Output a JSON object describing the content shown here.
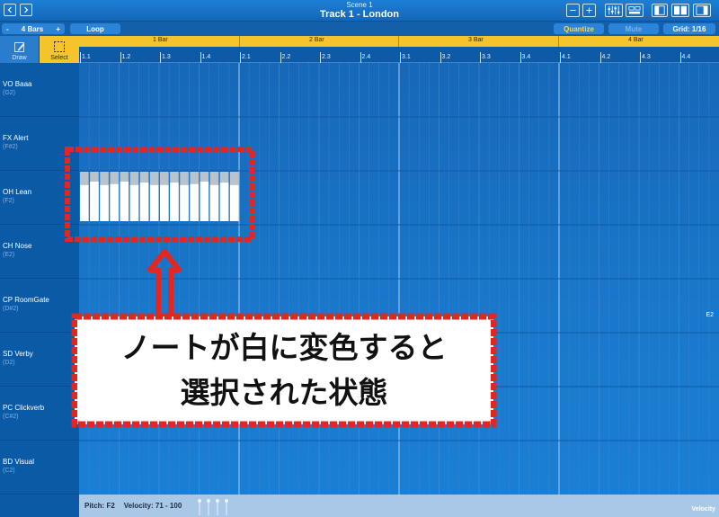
{
  "header": {
    "scene": "Scene 1",
    "track": "Track 1 - London"
  },
  "toolbar": {
    "minus": "-",
    "bars_label": "4 Bars",
    "plus": "+",
    "loop_label": "Loop",
    "quantize_label": "Quantize",
    "mute_label": "Mute",
    "grid_label": "Grid: 1/16"
  },
  "tools": {
    "draw_label": "Draw",
    "select_label": "Select"
  },
  "ruler": {
    "bars": [
      "1 Bar",
      "2 Bar",
      "3 Bar",
      "4 Bar"
    ],
    "beats": [
      "1.1",
      "1.2",
      "1.3",
      "1.4",
      "2.1",
      "2.2",
      "2.3",
      "2.4",
      "3.1",
      "3.2",
      "3.3",
      "3.4",
      "4.1",
      "4.2",
      "4.3",
      "4.4"
    ]
  },
  "tracks": [
    {
      "name": "VO Baaa",
      "note": "(G2)"
    },
    {
      "name": "FX Alert",
      "note": "(F#2)"
    },
    {
      "name": "OH Lean",
      "note": "(F2)"
    },
    {
      "name": "CH Nose",
      "note": "(E2)"
    },
    {
      "name": "CP RoomGate",
      "note": "(D#2)"
    },
    {
      "name": "SD Verby",
      "note": "(D2)"
    },
    {
      "name": "PC Clickverb",
      "note": "(C#2)"
    },
    {
      "name": "BD Visual",
      "note": "(C2)"
    }
  ],
  "edge_note": "E2",
  "notes": {
    "count": 16,
    "velocities": [
      0.73,
      0.8,
      0.73,
      0.75,
      0.8,
      0.73,
      0.78,
      0.73,
      0.73,
      0.78,
      0.73,
      0.75,
      0.8,
      0.73,
      0.78,
      0.73
    ]
  },
  "annotation": {
    "line1": "ノートが白に変色すると",
    "line2": "選択された状態",
    "color": "#e3261f"
  },
  "status": {
    "pitch": "Pitch: F2",
    "velocity": "Velocity: 71 - 100",
    "velocity_tab": "Velocity"
  },
  "colors": {
    "accent": "#f4c42a",
    "background": "#0b5aa6"
  }
}
